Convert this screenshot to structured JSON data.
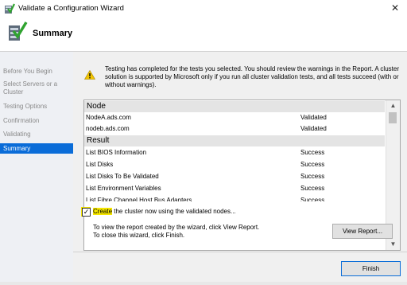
{
  "window": {
    "title": "Validate a Configuration Wizard",
    "close_glyph": "✕"
  },
  "header": {
    "title": "Summary"
  },
  "nav": {
    "items": [
      {
        "label": "Before You Begin"
      },
      {
        "label": "Select Servers or a Cluster"
      },
      {
        "label": "Testing Options"
      },
      {
        "label": "Confirmation"
      },
      {
        "label": "Validating"
      },
      {
        "label": "Summary",
        "active": true
      }
    ]
  },
  "main": {
    "info_text": "Testing has completed for the tests you selected. You should review the warnings in the Report.  A cluster solution is supported by Microsoft only if you run all cluster validation tests, and all tests succeed (with or without warnings).",
    "results": {
      "node_header": "Node",
      "nodes": [
        {
          "name": "NodeA.ads.com",
          "status": "Validated"
        },
        {
          "name": "nodeb.ads.com",
          "status": "Validated"
        }
      ],
      "result_header": "Result",
      "tests": [
        {
          "name": "List BIOS Information",
          "status": "Success"
        },
        {
          "name": "List Disks",
          "status": "Success"
        },
        {
          "name": "List Disks To Be Validated",
          "status": "Success"
        },
        {
          "name": "List Environment Variables",
          "status": "Success"
        },
        {
          "name": "List Fibre Channel Host Bus Adapters",
          "status": "Success"
        }
      ]
    },
    "create_cluster": {
      "label_highlight": "Create",
      "label_rest": " the cluster now using the validated nodes...",
      "checked": true,
      "check_glyph": "✓"
    },
    "report_line1": "To view the report created by the wizard, click View Report.",
    "report_line2": "To close this wizard, click Finish.",
    "view_report_label": "View Report...",
    "finish_label": "Finish"
  },
  "colors": {
    "accent": "#0a6cd8",
    "highlight": "#f5e600",
    "nav_bg": "#eef0f4"
  },
  "icons": {
    "app": "wizard-check-icon",
    "header": "cluster-validate-icon",
    "warning": "warning-icon"
  }
}
